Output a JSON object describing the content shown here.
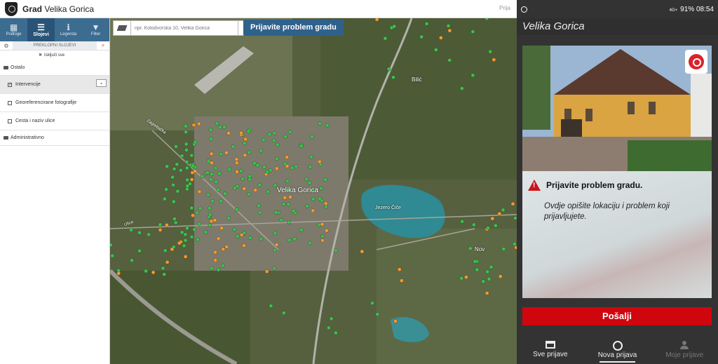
{
  "header": {
    "brand_bold": "Grad",
    "brand_rest": "Velika Gorica",
    "tab_peek": "Prija"
  },
  "sidebar": {
    "tools": [
      {
        "label": "Podloge",
        "icon": "map-icon"
      },
      {
        "label": "Slojevi",
        "icon": "layers-icon",
        "active": true
      },
      {
        "label": "Legenda",
        "icon": "info-icon"
      },
      {
        "label": "Filter",
        "icon": "filter-icon"
      }
    ],
    "subhead_title": "PREKLOPNI SLOJEVI",
    "clear_all": "Isključi sve",
    "layers": {
      "folder_ostalo": "Ostalo",
      "intervencije": "Intervencije",
      "foto": "Georeferencirane fotografije",
      "ceste": "Cesta i naziv ulice",
      "folder_admin": "Administrativno"
    }
  },
  "map": {
    "search_placeholder": "npr. Kolodvorska 10, Velika Gorica",
    "report_button": "Prijavite problem gradu",
    "labels": {
      "city": "Velika Gorica",
      "lake": "Jezero Čiče",
      "bilic": "Bilić",
      "nov": "Nov",
      "street_1": "Zagrebačka",
      "street_2": "Ulica"
    },
    "marker_colors": {
      "green": "#3cc14c",
      "orange": "#f39a2d"
    }
  },
  "phone": {
    "status": {
      "right": "91% 08:54",
      "signal": "4G+"
    },
    "app_title": "Velika Gorica",
    "warning_title": "Prijavite problem gradu.",
    "description": "Ovdje opišite lokaciju i problem koji prijavljujete.",
    "send_button": "Pošalji",
    "nav": {
      "all": "Sve prijave",
      "new": "Nova prijava",
      "mine": "Moje prijave"
    },
    "accent_color": "#d0060e"
  }
}
